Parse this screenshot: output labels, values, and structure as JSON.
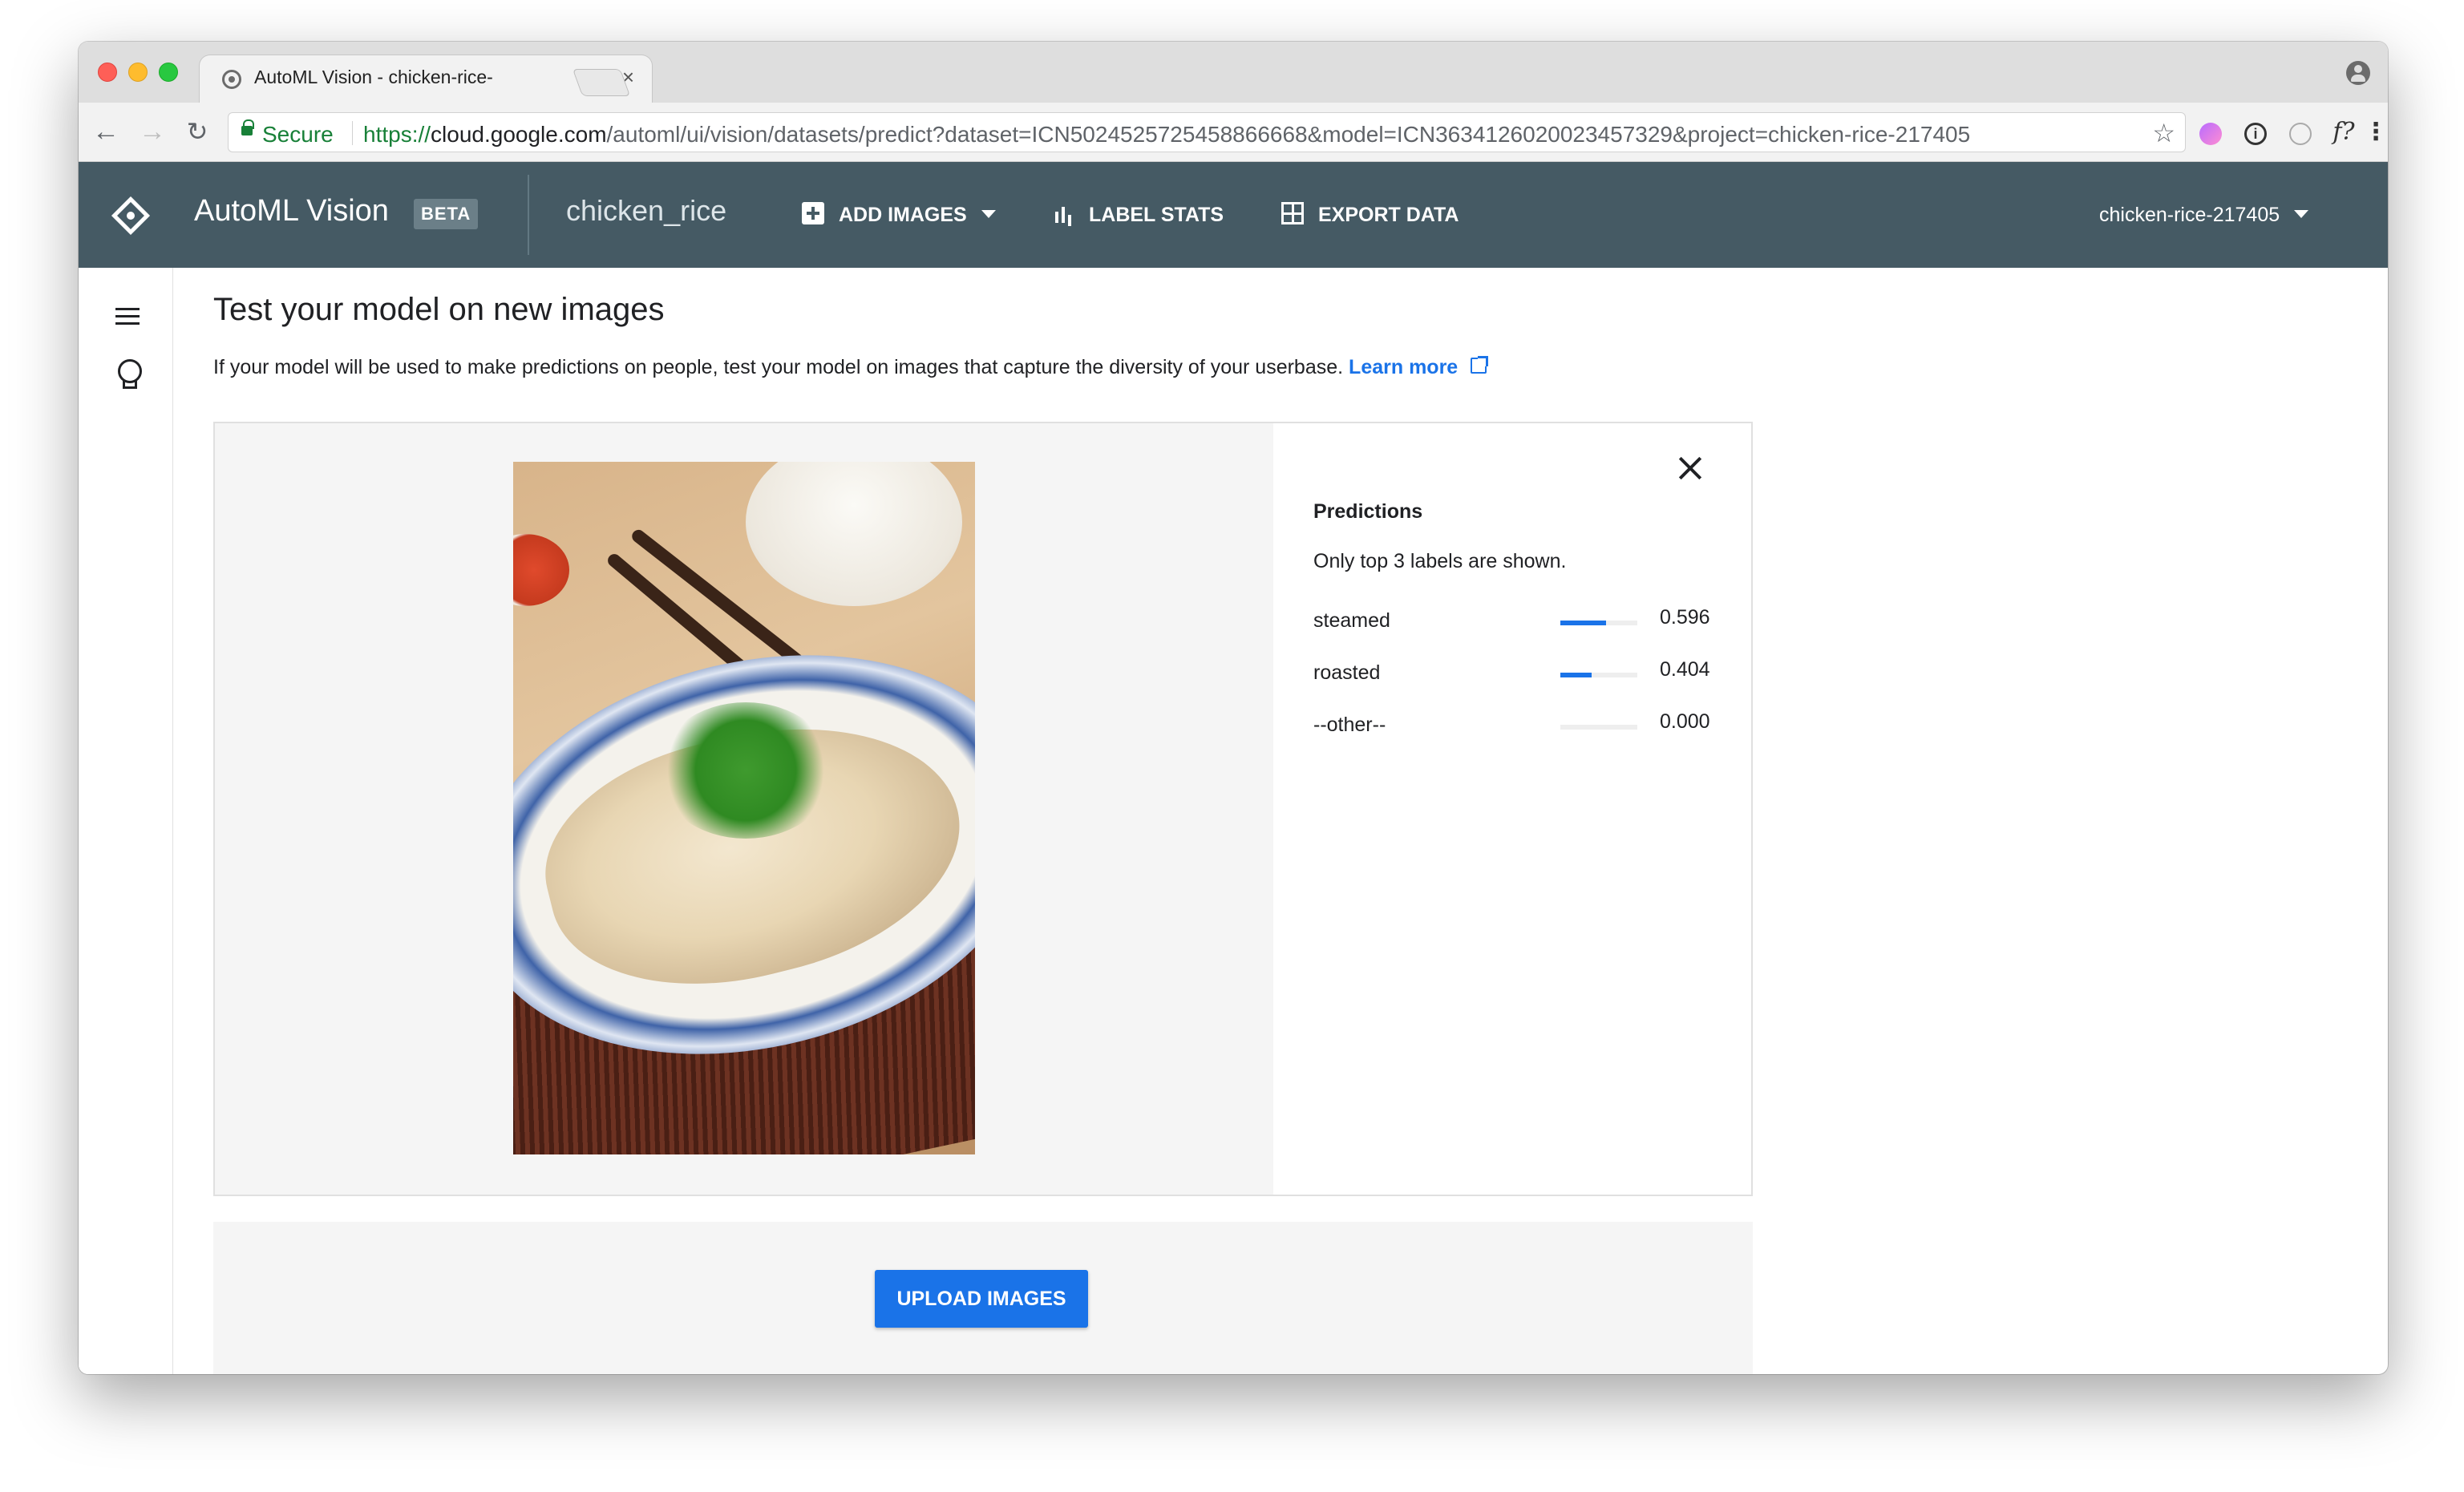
{
  "browser": {
    "tab_title": "AutoML Vision - chicken-rice-",
    "tab_close": "×",
    "secure_label": "Secure",
    "url_scheme": "https://",
    "url_host": "cloud.google.com",
    "url_path": "/automl/ui/vision/datasets/predict?dataset=ICN5024525725458866668&model=ICN3634126020023457329&project=chicken-rice-217405",
    "back_glyph": "←",
    "forward_glyph": "→",
    "reload_glyph": "↻",
    "star_glyph": "☆",
    "ext_info_glyph": "i",
    "ext_f_glyph": "f?",
    "menu_glyph": "⋮"
  },
  "header": {
    "app_name": "AutoML Vision",
    "beta_label": "BETA",
    "dataset_name": "chicken_rice",
    "actions": {
      "add_images": "ADD IMAGES",
      "label_stats": "LABEL STATS",
      "export_data": "EXPORT DATA"
    },
    "project": "chicken-rice-217405"
  },
  "main": {
    "title": "Test your model on new images",
    "description": "If your model will be used to make predictions on people, test your model on images that capture the diversity of your userbase.",
    "learn_more": "Learn more"
  },
  "predictions": {
    "title": "Predictions",
    "note": "Only top 3 labels are shown.",
    "items": [
      {
        "label": "steamed",
        "value": "0.596",
        "score": 0.596
      },
      {
        "label": "roasted",
        "value": "0.404",
        "score": 0.404
      },
      {
        "label": "--other--",
        "value": "0.000",
        "score": 0.0
      }
    ]
  },
  "upload": {
    "button_label": "UPLOAD IMAGES"
  },
  "colors": {
    "header_bg": "#455a64",
    "accent_blue": "#1a73e8",
    "secure_green": "#188038"
  }
}
